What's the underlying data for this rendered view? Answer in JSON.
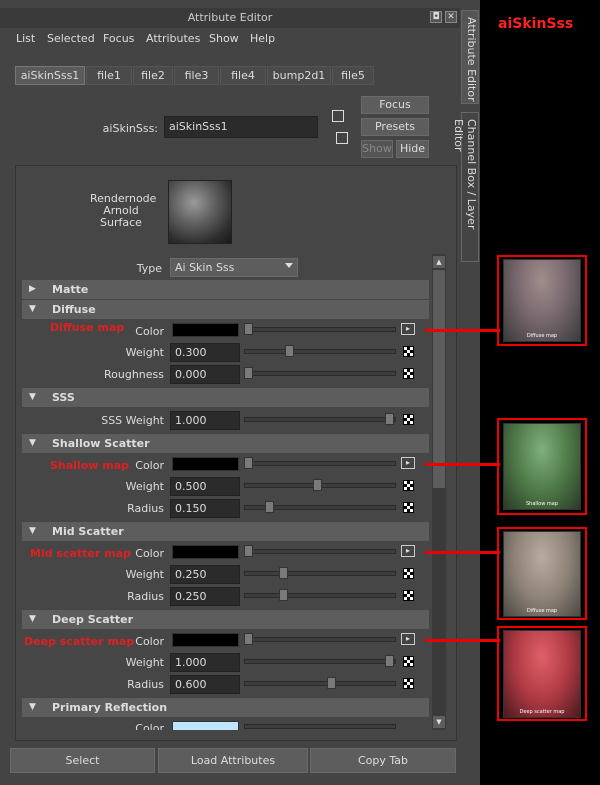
{
  "window": {
    "title": "Attribute Editor"
  },
  "menu": [
    "List",
    "Selected",
    "Focus",
    "Attributes",
    "Show",
    "Help"
  ],
  "tabs": [
    "aiSkinSss1",
    "file1",
    "file2",
    "file3",
    "file4",
    "bump2d1",
    "file5"
  ],
  "node": {
    "label": "aiSkinSss:",
    "value": "aiSkinSss1"
  },
  "buttons": {
    "focus": "Focus",
    "presets": "Presets",
    "show": "Show",
    "hide": "Hide"
  },
  "swatch_label": [
    "Rendernode",
    "Arnold",
    "Surface"
  ],
  "type": {
    "label": "Type",
    "value": "Ai Skin Sss"
  },
  "sections": {
    "matte": "Matte",
    "diffuse": "Diffuse",
    "sss": "SSS",
    "shallow": "Shallow Scatter",
    "mid": "Mid Scatter",
    "deep": "Deep Scatter",
    "primary": "Primary Reflection"
  },
  "fields": {
    "color": "Color",
    "weight": "Weight",
    "roughness": "Roughness",
    "radius": "Radius",
    "sss_weight": "SSS Weight",
    "diffuse_weight": "0.300",
    "diffuse_roughness": "0.000",
    "sss_weight_val": "1.000",
    "shallow_weight": "0.500",
    "shallow_radius": "0.150",
    "mid_weight": "0.250",
    "mid_radius": "0.250",
    "deep_weight": "1.000",
    "deep_radius": "0.600"
  },
  "annotations": {
    "diffuse": "Diffuse map",
    "shallow": "Shallow map",
    "mid": "Mid scatter map",
    "deep": "Deep scatter map"
  },
  "thumb_captions": {
    "diffuse": "Diffuse map",
    "shallow": "Shallow map",
    "mid": "Diffuse map",
    "deep": "Deep scatter map"
  },
  "bottom": {
    "select": "Select",
    "load": "Load Attributes",
    "copy": "Copy Tab"
  },
  "side_tabs": {
    "attr": "Attribute Editor",
    "channel": "Channel Box / Layer Editor"
  },
  "corner_title": "aiSkinSss",
  "colors": {
    "accent_red": "#e00000",
    "title_red": "#ff2020"
  }
}
